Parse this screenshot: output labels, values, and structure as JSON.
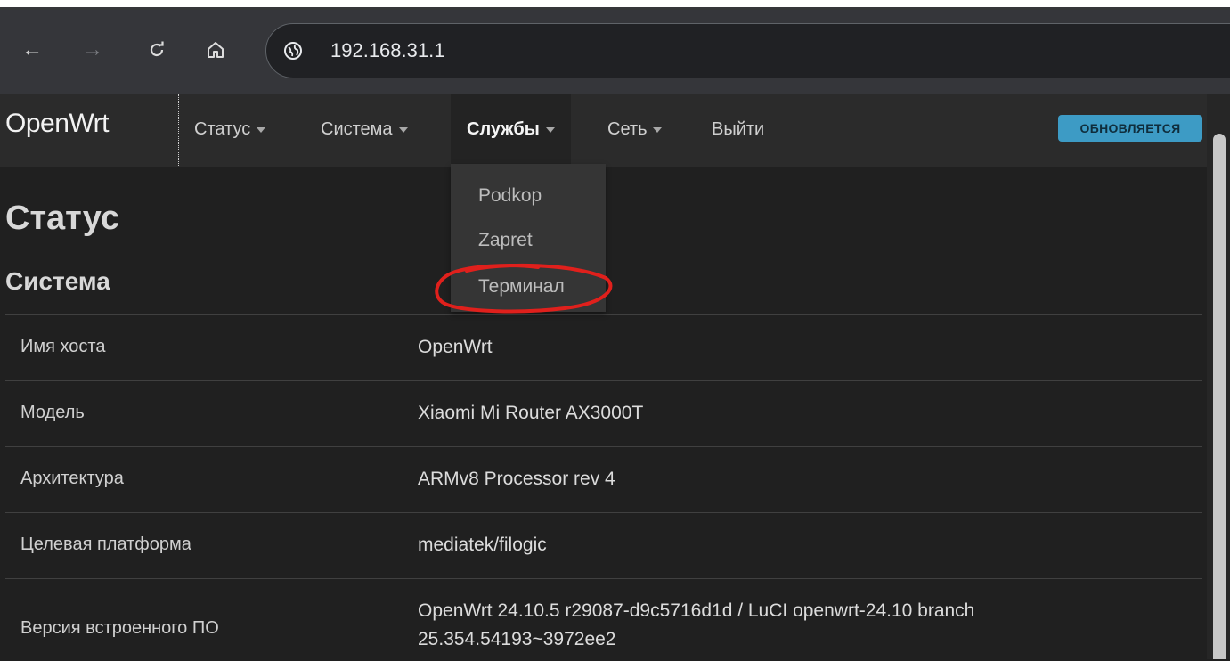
{
  "browser": {
    "url": "192.168.31.1"
  },
  "header": {
    "brand": "OpenWrt",
    "menu": [
      {
        "label": "Статус",
        "has_caret": true
      },
      {
        "label": "Система",
        "has_caret": true
      },
      {
        "label": "Службы",
        "has_caret": true
      },
      {
        "label": "Сеть",
        "has_caret": true
      },
      {
        "label": "Выйти",
        "has_caret": false
      }
    ],
    "badge": "ОБНОВЛЯЕТСЯ"
  },
  "dropdown": {
    "items": [
      "Podkop",
      "Zapret",
      "Терминал"
    ]
  },
  "page": {
    "title": "Статус",
    "section": "Система",
    "rows": [
      {
        "label": "Имя хоста",
        "value": "OpenWrt"
      },
      {
        "label": "Модель",
        "value": "Xiaomi Mi Router AX3000T"
      },
      {
        "label": "Архитектура",
        "value": "ARMv8 Processor rev 4"
      },
      {
        "label": "Целевая платформа",
        "value": "mediatek/filogic"
      },
      {
        "label": "Версия встроенного ПО",
        "value_line1": "OpenWrt 24.10.5 r29087-d9c5716d1d / LuCI openwrt-24.10 branch",
        "value_line2": "25.354.54193~3972ee2"
      }
    ]
  },
  "colors": {
    "badge": "#3d9bc5",
    "annotation": "#e0201c",
    "background": "#202020"
  }
}
